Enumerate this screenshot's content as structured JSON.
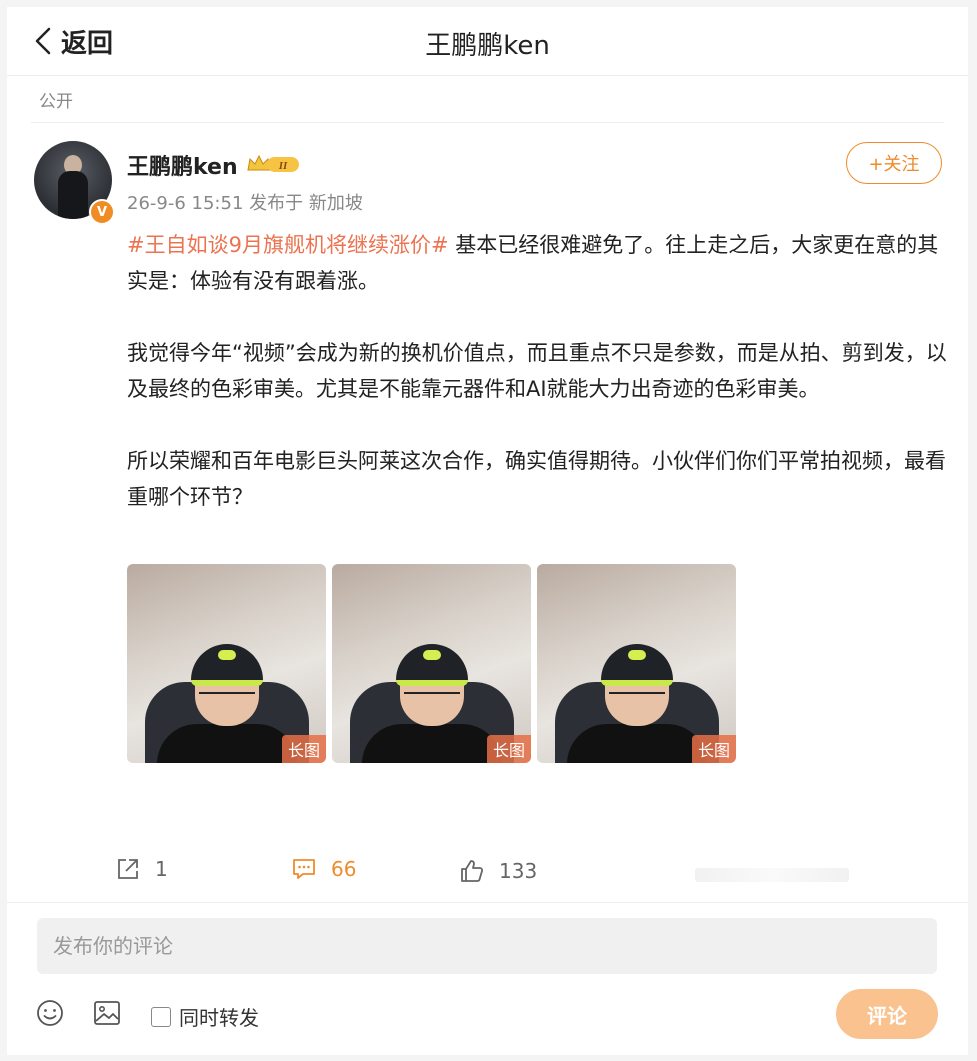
{
  "header": {
    "back_label": "返回",
    "title": "王鹏鹏ken"
  },
  "visibility": "公开",
  "author": {
    "name": "王鹏鹏ken",
    "vip_level": "II",
    "verified_badge": "V",
    "timestamp": "26-9-6 15:51",
    "published_from": "发布于 新加坡",
    "follow_label": "+关注"
  },
  "post": {
    "hashtag": "#王自如谈9月旗舰机将继续涨价#",
    "p1_rest": " 基本已经很难避免了。往上走之后，大家更在意的其实是：体验有没有跟着涨。",
    "p2": "我觉得今年“视频”会成为新的换机价值点，而且重点不只是参数，而是从拍、剪到发，以及最终的色彩审美。尤其是不能靠元器件和AI就能大力出奇迹的色彩审美。",
    "p3": "所以荣耀和百年电影巨头阿莱这次合作，确实值得期待。小伙伴们你们平常拍视频，最看重哪个环节？"
  },
  "images": [
    {
      "tag": "长图"
    },
    {
      "tag": "长图"
    },
    {
      "tag": "长图"
    }
  ],
  "actions": {
    "share_count": "1",
    "comment_count": "66",
    "like_count": "133"
  },
  "composer": {
    "placeholder": "发布你的评论",
    "repost_label": "同时转发",
    "submit_label": "评论"
  },
  "colors": {
    "accent": "#ef8b2c",
    "hashtag": "#eb7350",
    "submit_disabled": "#f9c28e"
  }
}
